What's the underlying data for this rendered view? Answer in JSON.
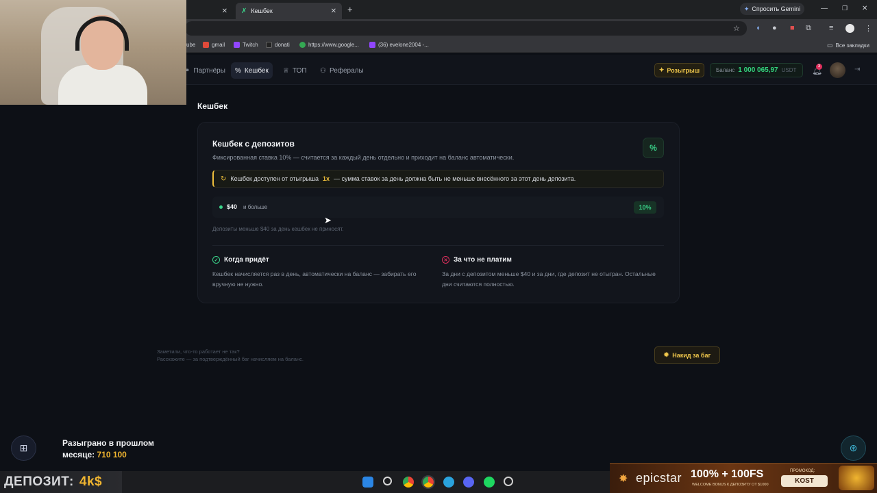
{
  "browser": {
    "tabs": [
      {
        "label": "",
        "active": false
      },
      {
        "label": "Кешбек",
        "active": true
      }
    ],
    "new_tab": "+",
    "gemini_button": "Спросить Gemini",
    "bookmarks": [
      {
        "label": "ube"
      },
      {
        "label": "gmail"
      },
      {
        "label": "Twitch"
      },
      {
        "label": "donati"
      },
      {
        "label": "https://www.google..."
      },
      {
        "label": "(36) evelone2004 -..."
      }
    ],
    "all_bookmarks": "Все закладки"
  },
  "header": {
    "nav": [
      {
        "label": "Партнёры",
        "icon": "handshake-icon",
        "active": false
      },
      {
        "label": "Кешбек",
        "icon": "percent-icon",
        "active": true
      },
      {
        "label": "ТОП",
        "icon": "trophy-icon",
        "active": false
      },
      {
        "label": "Рефералы",
        "icon": "users-icon",
        "active": false
      }
    ],
    "promo_button": "Розыгрыш",
    "balance_label": "Баланс",
    "balance_amount": "1 000 065,97",
    "balance_currency": "USDT",
    "notification_count": "3"
  },
  "main": {
    "page_title": "Кешбек",
    "card": {
      "title": "Кешбек с депозитов",
      "subtitle": "Фиксированная ставка 10% — считается за каждый день отдельно и приходит на баланс автоматически.",
      "badge": "%",
      "notice_prefix": "Кешбек доступен от отыгрыша",
      "notice_highlight": "1x",
      "notice_suffix": "— сумма ставок за день должна быть не меньше внесённого за этот день депозита.",
      "tier": {
        "amount": "$40",
        "label": "и больше",
        "rate": "10%"
      },
      "footnote": "Депозиты меньше $40 за день кешбек не приносят.",
      "when_title": "Когда придёт",
      "when_text": "Кешбек начисляется раз в день, автоматически на баланс — забирать его вручную не нужно.",
      "not_paid_title": "За что не платим",
      "not_paid_text": "За дни с депозитом меньше $40 и за дни, где депозит не отыгран. Остальные дни считаются полностью."
    }
  },
  "footer": {
    "line1": "Заметили, что-то работает не так?",
    "line2": "Расскажите — за подтверждённый баг начисляем на баланс.",
    "bug_button": "Накид за баг"
  },
  "gift_widget": {
    "line1": "Разыграно в прошлом",
    "line2_label": "месяце:",
    "line2_value": "710 100"
  },
  "overlay": {
    "deposit_label": "ДЕПОЗИТ:",
    "deposit_value": "4k$"
  },
  "ad_banner": {
    "brand": "epicstar",
    "offer": "100% + 100FS",
    "offer_sub": "WELCOME BONUS К ДЕПОЗИТУ ОТ $1000",
    "promo_label": "ПРОМОКОД:",
    "promo_code": "KOST"
  },
  "colors": {
    "accent_green": "#3ad48a",
    "accent_yellow": "#f0c03c",
    "error_red": "#e0305e",
    "background": "#0d1016"
  }
}
